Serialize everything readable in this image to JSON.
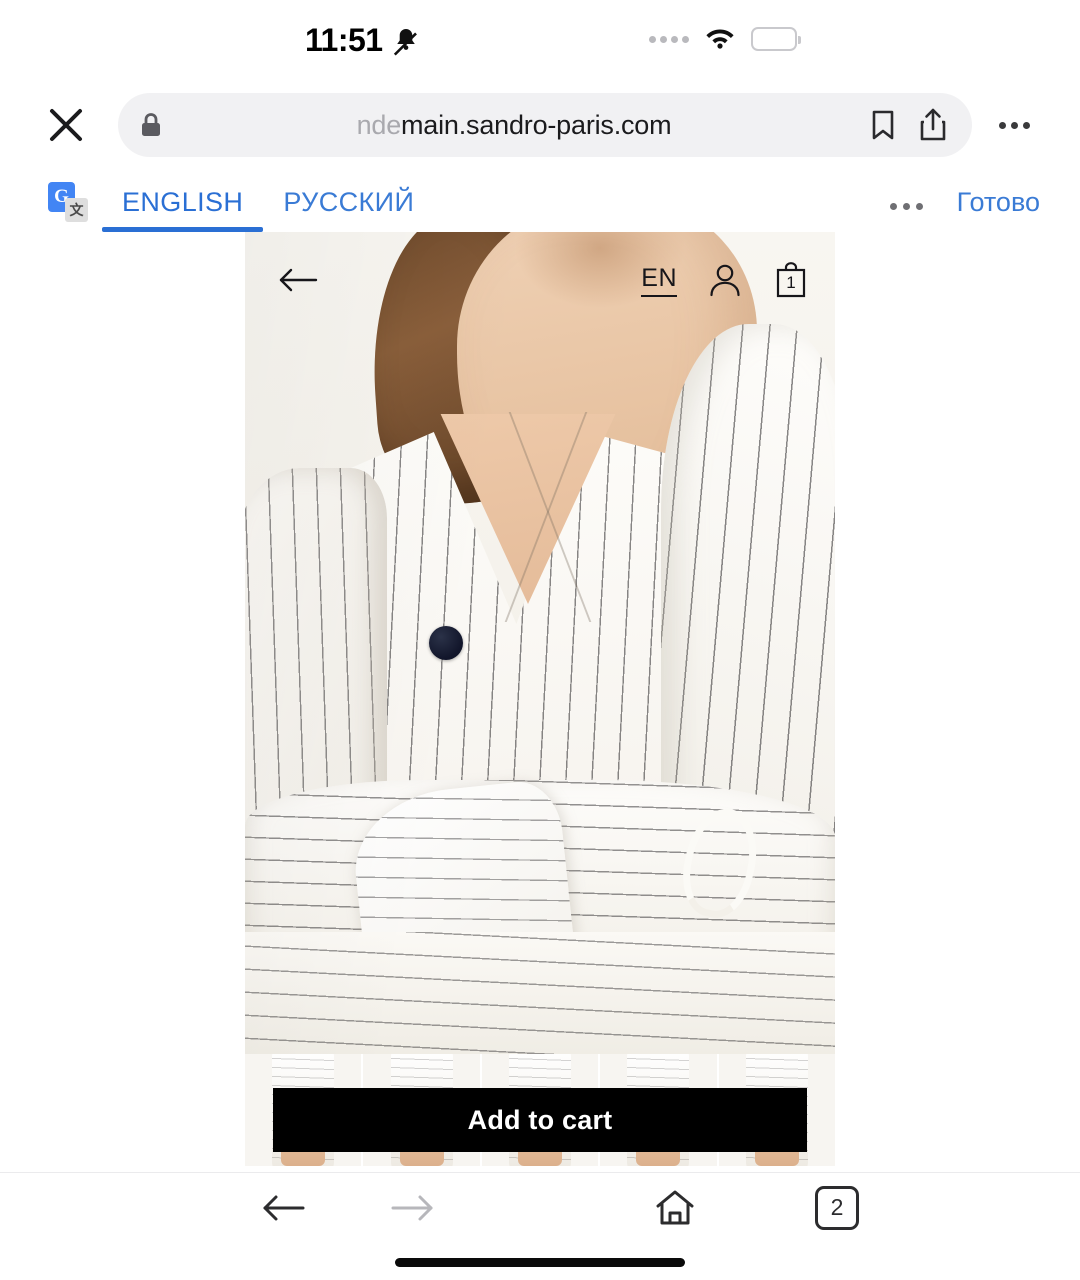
{
  "status_bar": {
    "time": "11:51",
    "notification_icon": "bell-muted-icon",
    "signal_icon": "cellular-dots-icon",
    "wifi_icon": "wifi-icon",
    "battery_icon": "battery-full-icon"
  },
  "browser": {
    "close_icon": "close-icon",
    "lock_icon": "lock-icon",
    "url_dim_prefix": "nde",
    "url": "main.sandro-paris.com",
    "bookmark_icon": "bookmark-icon",
    "share_icon": "share-icon",
    "overflow_icon": "more-options-icon",
    "bottom": {
      "back_icon": "arrow-back-icon",
      "forward_icon": "arrow-forward-icon",
      "home_icon": "home-icon",
      "tab_count": "2"
    }
  },
  "translate_bar": {
    "logo": "google-translate-icon",
    "tabs": [
      {
        "label": "ENGLISH",
        "active": true
      },
      {
        "label": "РУССКИЙ",
        "active": false
      }
    ],
    "overflow_icon": "more-options-icon",
    "done_label": "Готово",
    "accent_color": "#3a7bd5"
  },
  "site": {
    "header": {
      "back_icon": "arrow-left-icon",
      "language_label": "EN",
      "account_icon": "user-icon",
      "bag_icon": "shopping-bag-icon",
      "bag_count": "1"
    },
    "product": {
      "image_alt": "model-wearing-white-pinstripe-wrap-blouse",
      "thumbnails_count": 5
    },
    "add_to_cart_label": "Add to cart",
    "button_color": "#000000"
  }
}
